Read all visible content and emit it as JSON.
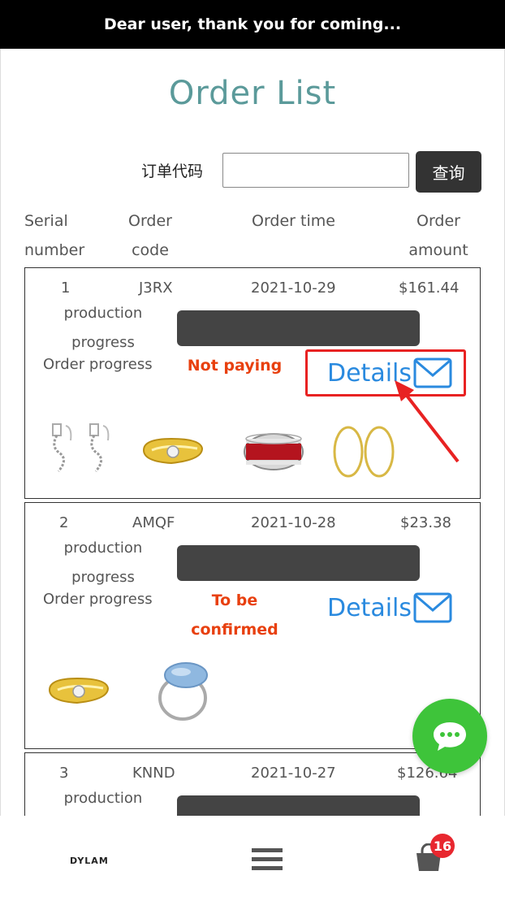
{
  "banner": {
    "text": "Dear user, thank you for coming..."
  },
  "page": {
    "title": "Order List"
  },
  "search": {
    "label": "订单代码",
    "value": "",
    "placeholder": "",
    "button_label": "查询"
  },
  "table_headers": {
    "serial": [
      "Serial",
      "number"
    ],
    "code": [
      "Order",
      "code"
    ],
    "time": "Order time",
    "amount": [
      "Order",
      "amount"
    ]
  },
  "labels": {
    "production": [
      "production",
      "progress"
    ],
    "order_progress": "Order progress",
    "details": "Details"
  },
  "orders": [
    {
      "serial": "1",
      "code": "J3RX",
      "time": "2021-10-29",
      "amount": "$161.44",
      "status": [
        "Not paying"
      ],
      "products": [
        "chain-drop-earrings",
        "gold-zircon-ring",
        "red-crystal-ring",
        "gold-hoop-earrings"
      ]
    },
    {
      "serial": "2",
      "code": "AMQF",
      "time": "2021-10-28",
      "amount": "$23.38",
      "status": [
        "To be",
        "confirmed"
      ],
      "products": [
        "gold-zircon-ring",
        "blue-opal-ring"
      ]
    },
    {
      "serial": "3",
      "code": "KNND",
      "time": "2021-10-27",
      "amount": "$126.64",
      "status": [],
      "products": []
    }
  ],
  "footer": {
    "brand": "DYLAM",
    "cart_count": "16"
  },
  "colors": {
    "title": "#5b9a9a",
    "status": "#e8400f",
    "details": "#2a8adf",
    "chat": "#3ec43a",
    "badge": "#e8272f",
    "highlight": "#e82222"
  },
  "icons": [
    "mail-icon",
    "chat-icon",
    "menu-icon",
    "shopping-bag-icon",
    "arrow-annotation"
  ]
}
